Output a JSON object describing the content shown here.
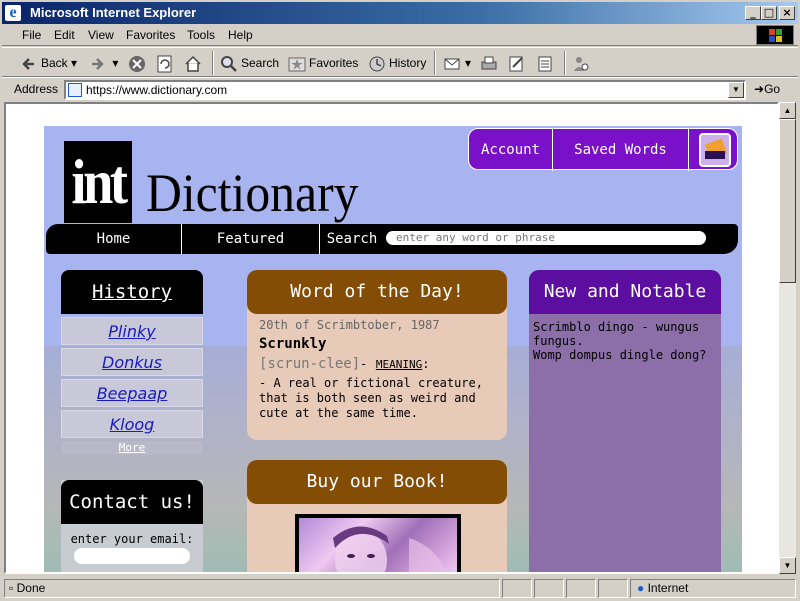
{
  "window": {
    "title": "Microsoft Internet Explorer"
  },
  "menu": [
    "File",
    "Edit",
    "View",
    "Favorites",
    "Tools",
    "Help"
  ],
  "toolbar": {
    "back": "Back",
    "search": "Search",
    "favorites": "Favorites",
    "history": "History"
  },
  "address": {
    "label": "Address",
    "url": "https://www.dictionary.com",
    "go": "Go"
  },
  "status": {
    "text": "Done",
    "zone": "Internet"
  },
  "site": {
    "logo_int": "int",
    "logo_dict": "Dictionary",
    "account": "Account",
    "saved_words": "Saved Words",
    "nav": {
      "home": "Home",
      "featured": "Featured",
      "search": "Search",
      "search_placeholder": "enter any word or phrase"
    },
    "history": {
      "title": "History",
      "items": [
        "Plinky",
        "Donkus",
        "Beepaap",
        "Kloog"
      ],
      "more": "More"
    },
    "contact": {
      "title": "Contact us!",
      "label": "enter your email:"
    },
    "wotd": {
      "title": "Word of the Day!",
      "date": "20th of Scrimbtober, 1987",
      "word": "Scrunkly",
      "pronunciation": "[scrun-clee]",
      "dash": "-",
      "meaning_label": "MEANING",
      "colon": ":",
      "definition": "- A real or fictional creature, that is both seen as weird and cute at the same time."
    },
    "book": {
      "title": "Buy our Book!"
    },
    "new": {
      "title": "New and Notable",
      "items": [
        "Scrimblo dingo - wungus fungus.",
        "Womp dompus dingle dong?"
      ]
    }
  }
}
